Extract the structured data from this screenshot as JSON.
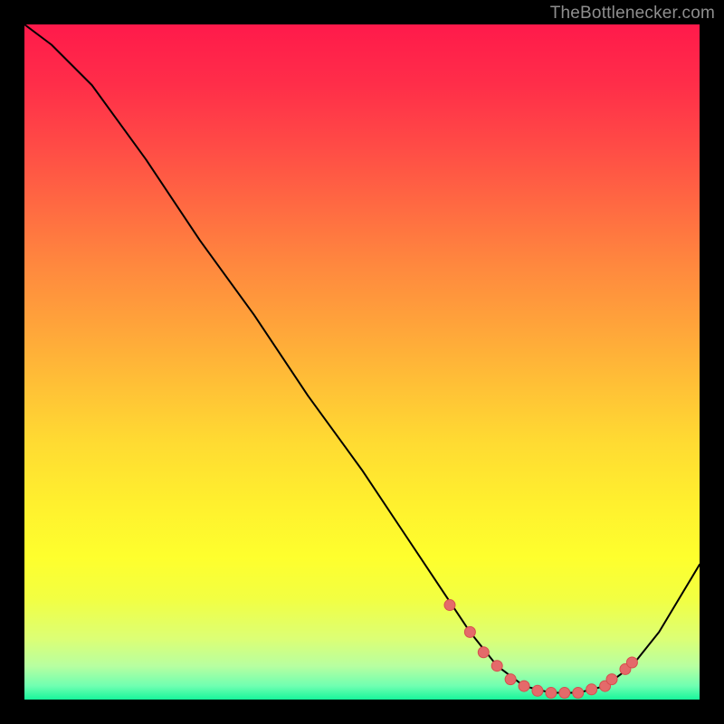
{
  "watermark": "TheBottlenecker.com",
  "colors": {
    "curve_stroke": "#000000",
    "marker_fill": "#e46a6a",
    "marker_stroke": "#d64e4e"
  },
  "chart_data": {
    "type": "line",
    "title": "",
    "xlabel": "",
    "ylabel": "",
    "xlim": [
      0,
      100
    ],
    "ylim": [
      0,
      100
    ],
    "series": [
      {
        "name": "bottleneck-curve",
        "x": [
          0,
          4,
          10,
          18,
          26,
          34,
          42,
          50,
          56,
          62,
          66,
          70,
          74,
          78,
          82,
          86,
          90,
          94,
          100
        ],
        "y": [
          100,
          97,
          91,
          80,
          68,
          57,
          45,
          34,
          25,
          16,
          10,
          5,
          2,
          1,
          1,
          2,
          5,
          10,
          20
        ]
      }
    ],
    "markers": {
      "name": "highlight-points",
      "x": [
        63,
        66,
        68,
        70,
        72,
        74,
        76,
        78,
        80,
        82,
        84,
        86,
        87,
        89,
        90
      ],
      "y": [
        14,
        10,
        7,
        5,
        3,
        2,
        1.3,
        1,
        1,
        1,
        1.5,
        2,
        3,
        4.5,
        5.5
      ]
    }
  }
}
